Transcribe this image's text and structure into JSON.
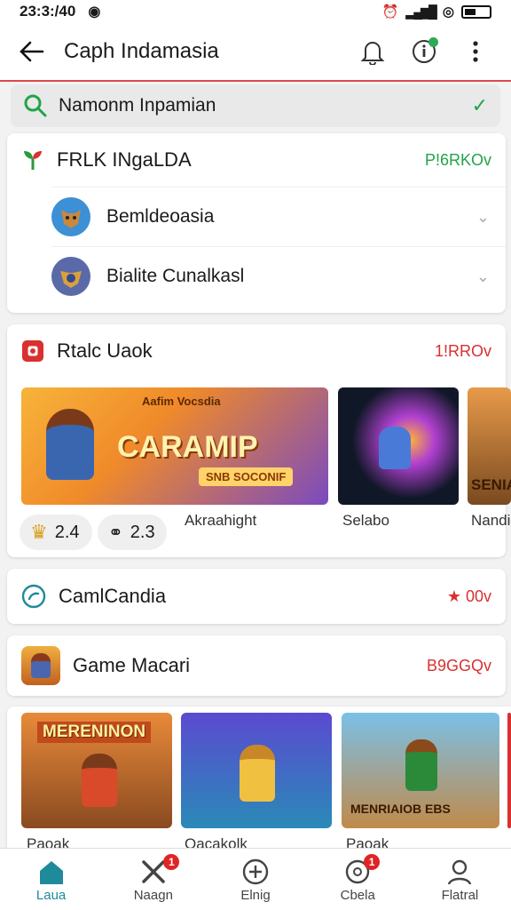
{
  "status": {
    "time": "23:3:/40",
    "signal": "$$"
  },
  "appbar": {
    "title": "Caph Indamasia"
  },
  "search": {
    "value": "Namonm Inpamian"
  },
  "section1": {
    "title": "FRLK INgaLDA",
    "more": "P!6RKOv",
    "items": [
      {
        "label": "Bemldeoasia"
      },
      {
        "label": "Bialite Cunalkasl"
      }
    ]
  },
  "section2": {
    "title": "Rtalc Uaok",
    "more": "1!RROv",
    "captions": [
      "Akraahight",
      "Selabo",
      "Nandi"
    ],
    "banner_text": "CARAMIP",
    "banner_sub": "SNB SOCONIF",
    "banner_top": "Aafim Vocsdia",
    "third_text": "SENIA",
    "pills": [
      {
        "value": "2.4"
      },
      {
        "value": "2.3"
      }
    ]
  },
  "section3": {
    "title": "CamlCandia",
    "more": "★ 00v"
  },
  "section4": {
    "title": "Game Macari",
    "more": "B9GGQv",
    "tiles": [
      "MERENINON",
      "",
      "MENRIAIOB EBS"
    ],
    "captions": [
      "Paoak",
      "Qacakolk",
      "Paoak"
    ]
  },
  "nav": {
    "items": [
      {
        "label": "Laua",
        "badge": ""
      },
      {
        "label": "Naagn",
        "badge": "1"
      },
      {
        "label": "Elnig",
        "badge": ""
      },
      {
        "label": "Cbela",
        "badge": "1"
      },
      {
        "label": "Flatral",
        "badge": ""
      }
    ]
  },
  "colors": {
    "accent": "#22a34a",
    "brand_red": "#d93030",
    "nav_active": "#1f8a9a"
  }
}
